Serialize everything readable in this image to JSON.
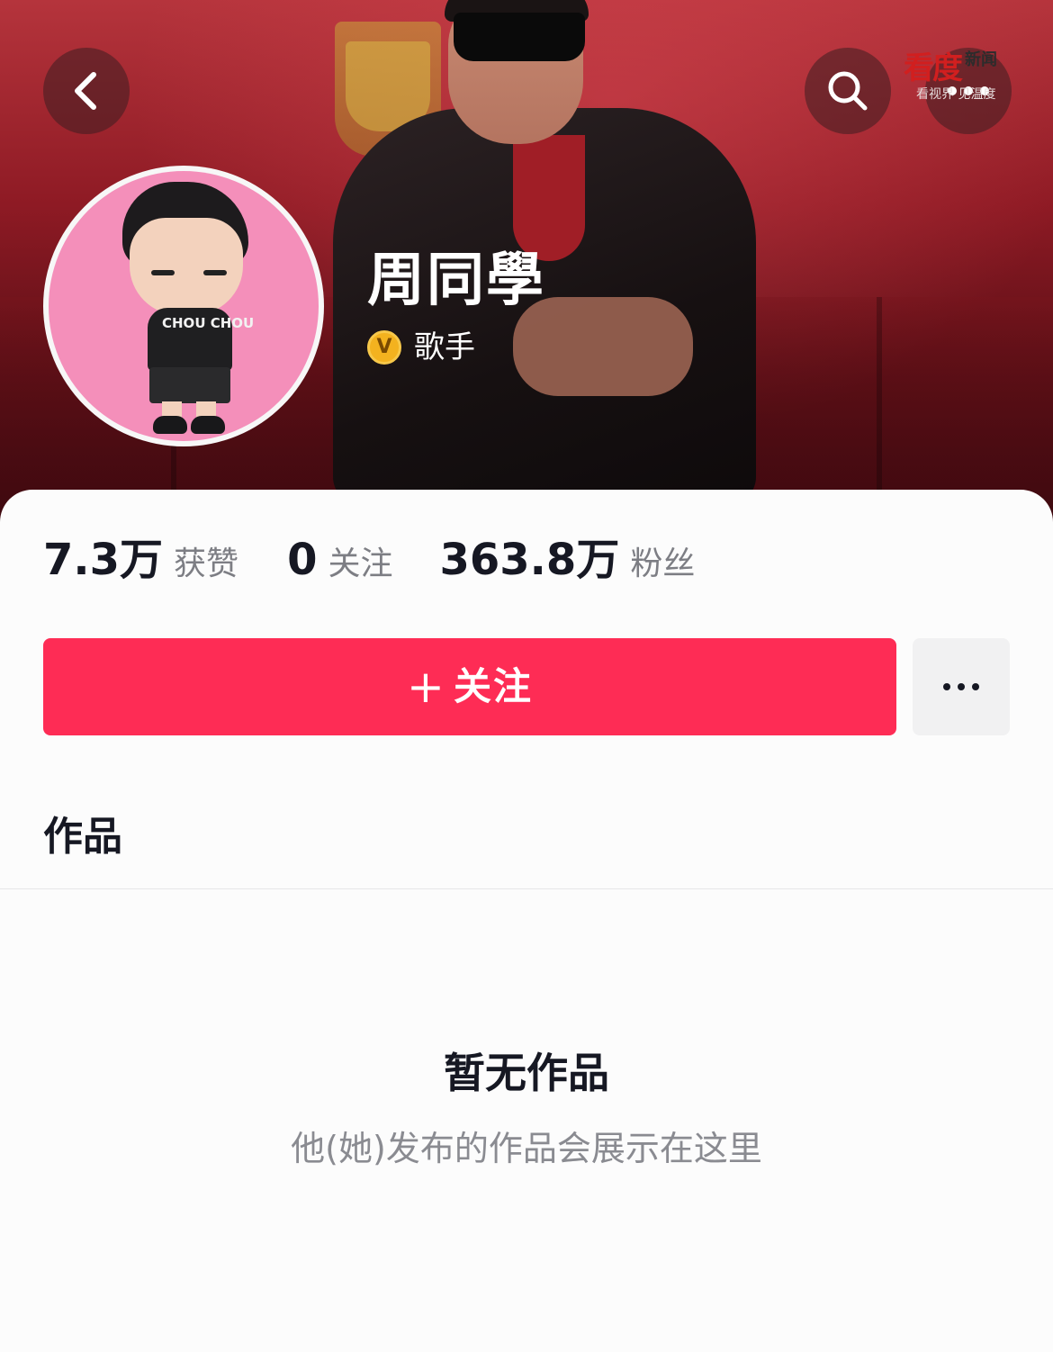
{
  "header": {
    "back_icon": "chevron-left-icon",
    "search_icon": "search-icon",
    "more_icon": "more-horizontal-icon"
  },
  "watermark": {
    "main": "看度",
    "side": "新闻",
    "sub": "看视界 见温度"
  },
  "profile": {
    "name": "周同學",
    "verified_badge": "V",
    "verified_label": "歌手",
    "avatar_text": "CHOU CHOU"
  },
  "stats": [
    {
      "value": "7.3万",
      "label": "获赞"
    },
    {
      "value": "0",
      "label": "关注"
    },
    {
      "value": "363.8万",
      "label": "粉丝"
    }
  ],
  "actions": {
    "follow_plus": "+",
    "follow_label": "关注",
    "more_label": "..."
  },
  "tabs": {
    "works": "作品"
  },
  "empty_state": {
    "title": "暂无作品",
    "subtitle": "他(她)发布的作品会展示在这里"
  },
  "colors": {
    "accent": "#fe2c55",
    "verify_gold": "#f3b21f",
    "text_primary": "#161823",
    "text_secondary": "#7d7e84"
  }
}
